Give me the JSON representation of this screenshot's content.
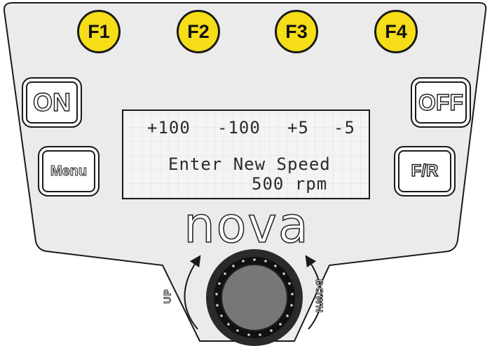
{
  "function_keys": [
    "F1",
    "F2",
    "F3",
    "F4"
  ],
  "side_keys": {
    "on": "ON",
    "off": "OFF",
    "menu": "Menu",
    "forward_reverse": "F/R"
  },
  "display": {
    "softkey_labels": [
      "+100",
      "-100",
      "+5",
      "-5"
    ],
    "prompt": "Enter New Speed",
    "value": "500 rpm"
  },
  "brand": "nova",
  "knob": {
    "up_label": "UP",
    "down_label": "DOWN"
  },
  "colors": {
    "function_key_fill": "#f5dd17",
    "panel_fill": "#ebebeb",
    "outline": "#1a1a1a",
    "lcd_background": "#f4f4f4",
    "knob_face": "#777777"
  },
  "icons": {
    "knob": "rotary-knob",
    "up_arrow": "curved-arrow-up-icon",
    "down_arrow": "curved-arrow-down-icon"
  }
}
